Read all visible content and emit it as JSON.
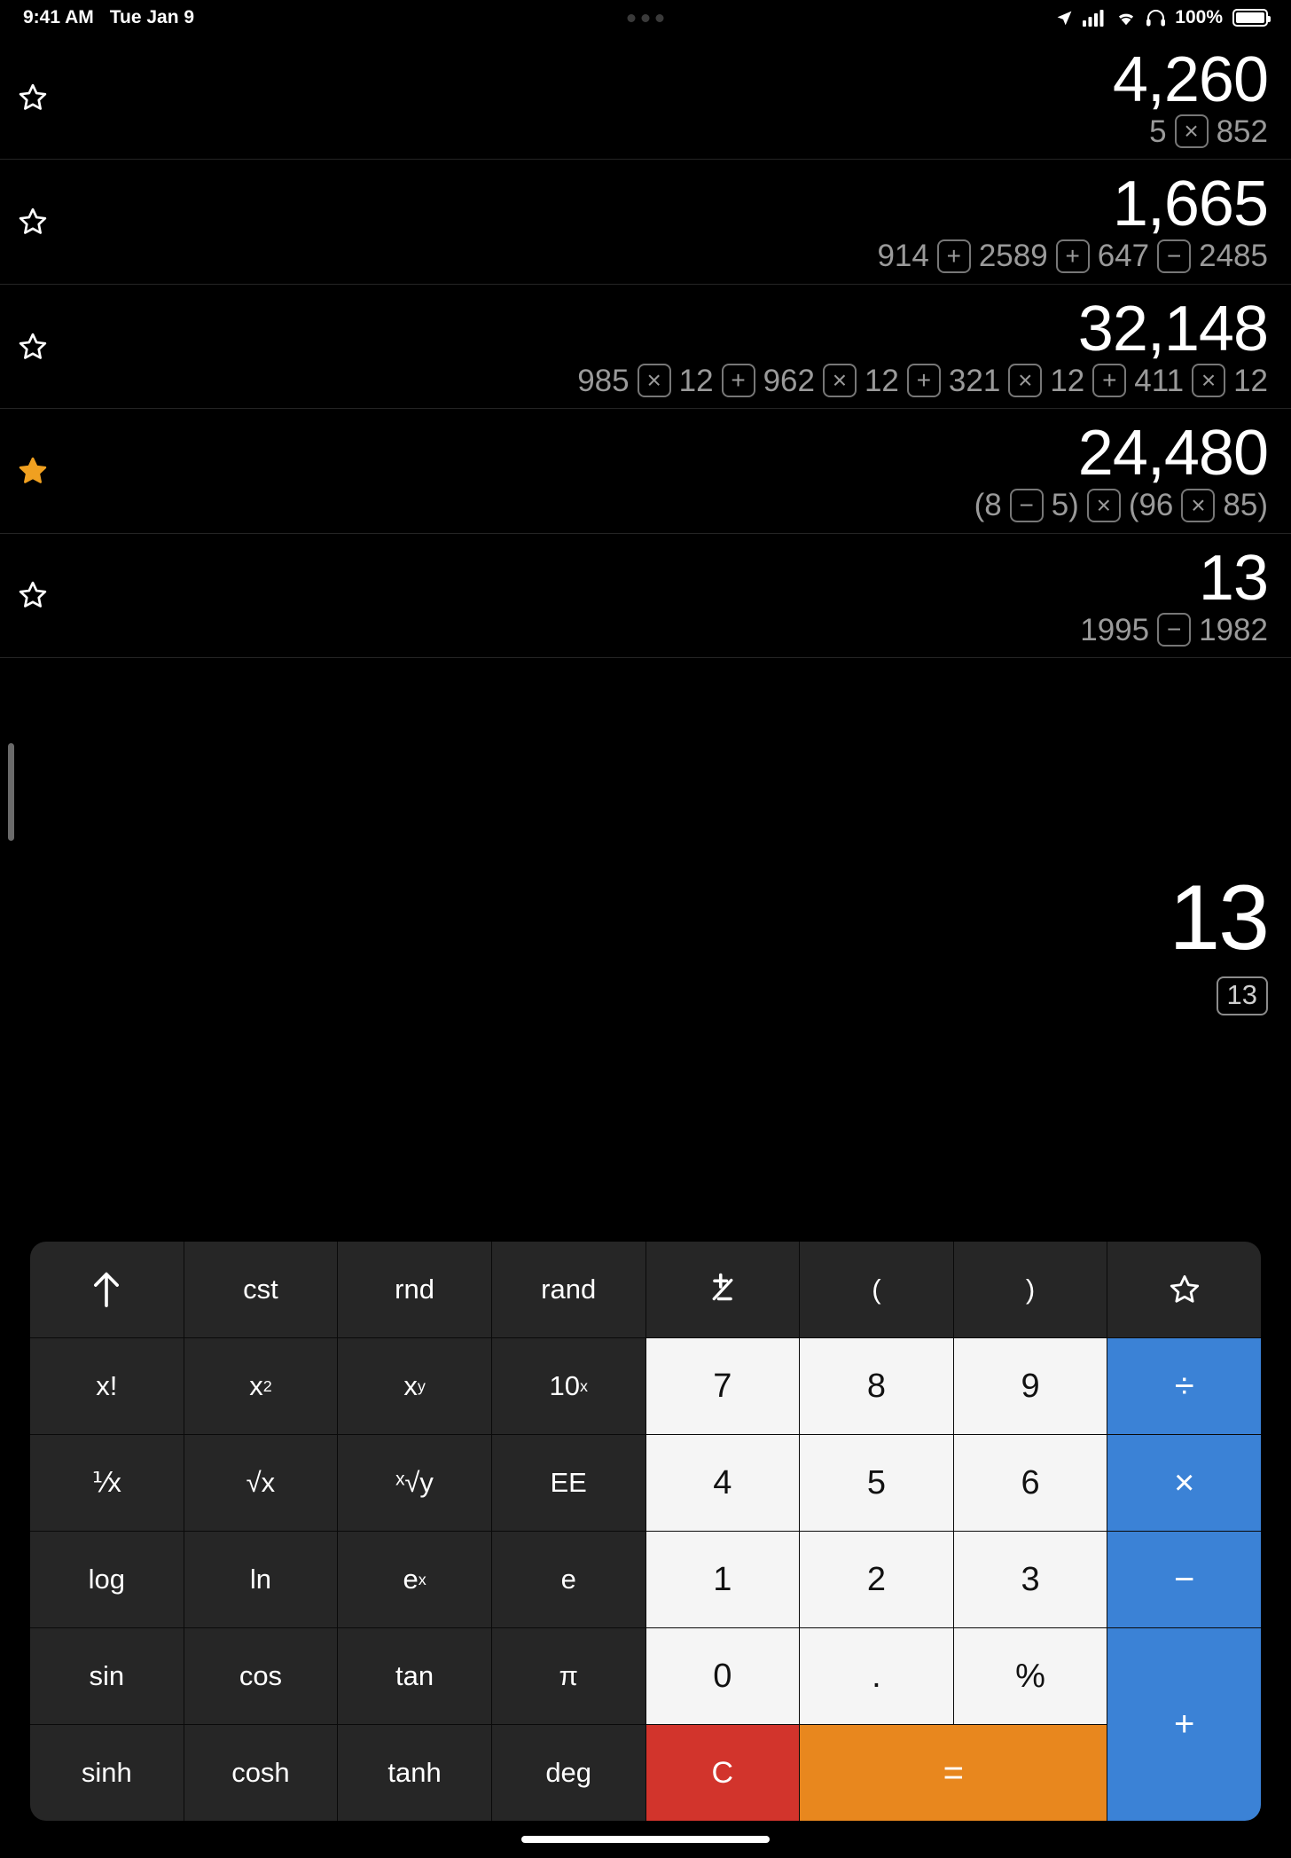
{
  "status_bar": {
    "time": "9:41 AM",
    "date": "Tue Jan 9",
    "battery_percent": "100%",
    "icons": [
      "location-arrow-icon",
      "cellular-signal-icon",
      "wifi-icon",
      "headphones-icon",
      "battery-icon"
    ]
  },
  "history": [
    {
      "starred": false,
      "result": "4,260",
      "tokens": [
        {
          "type": "num",
          "text": "5"
        },
        {
          "type": "op",
          "text": "×"
        },
        {
          "type": "num",
          "text": "852"
        }
      ]
    },
    {
      "starred": false,
      "result": "1,665",
      "tokens": [
        {
          "type": "num",
          "text": "914"
        },
        {
          "type": "op",
          "text": "+"
        },
        {
          "type": "num",
          "text": "2589"
        },
        {
          "type": "op",
          "text": "+"
        },
        {
          "type": "num",
          "text": "647"
        },
        {
          "type": "op",
          "text": "−"
        },
        {
          "type": "num",
          "text": "2485"
        }
      ]
    },
    {
      "starred": false,
      "result": "32,148",
      "tokens": [
        {
          "type": "num",
          "text": "985"
        },
        {
          "type": "op",
          "text": "×"
        },
        {
          "type": "num",
          "text": "12"
        },
        {
          "type": "op",
          "text": "+"
        },
        {
          "type": "num",
          "text": "962"
        },
        {
          "type": "op",
          "text": "×"
        },
        {
          "type": "num",
          "text": "12"
        },
        {
          "type": "op",
          "text": "+"
        },
        {
          "type": "num",
          "text": "321"
        },
        {
          "type": "op",
          "text": "×"
        },
        {
          "type": "num",
          "text": "12"
        },
        {
          "type": "op",
          "text": "+"
        },
        {
          "type": "num",
          "text": "411"
        },
        {
          "type": "op",
          "text": "×"
        },
        {
          "type": "num",
          "text": "12"
        }
      ]
    },
    {
      "starred": true,
      "result": "24,480",
      "tokens": [
        {
          "type": "num",
          "text": "(8"
        },
        {
          "type": "op",
          "text": "−"
        },
        {
          "type": "num",
          "text": "5)"
        },
        {
          "type": "op",
          "text": "×"
        },
        {
          "type": "num",
          "text": "(96"
        },
        {
          "type": "op",
          "text": "×"
        },
        {
          "type": "num",
          "text": "85)"
        }
      ]
    },
    {
      "starred": false,
      "result": "13",
      "tokens": [
        {
          "type": "num",
          "text": "1995"
        },
        {
          "type": "op",
          "text": "−"
        },
        {
          "type": "num",
          "text": "1982"
        }
      ]
    }
  ],
  "current": {
    "result": "13",
    "expression_chip": "13"
  },
  "keypad": {
    "rows": [
      [
        {
          "label": "↑",
          "kind": "fn",
          "name": "key-up-arrow",
          "icon": "arrow-up-icon"
        },
        {
          "label": "cst",
          "kind": "fn",
          "name": "key-cst"
        },
        {
          "label": "rnd",
          "kind": "fn",
          "name": "key-rnd"
        },
        {
          "label": "rand",
          "kind": "fn",
          "name": "key-rand"
        },
        {
          "label": "±",
          "kind": "fn",
          "name": "key-plus-minus",
          "icon": "plus-minus-icon"
        },
        {
          "label": "(",
          "kind": "fn",
          "name": "key-open-paren"
        },
        {
          "label": ")",
          "kind": "fn",
          "name": "key-close-paren"
        },
        {
          "label": "☆",
          "kind": "fn",
          "name": "key-favorite",
          "icon": "star-outline-icon"
        }
      ],
      [
        {
          "label": "x!",
          "kind": "fn",
          "name": "key-factorial"
        },
        {
          "label": "x2",
          "kind": "fn",
          "name": "key-x-squared",
          "base": "x",
          "sup": "2"
        },
        {
          "label": "xy",
          "kind": "fn",
          "name": "key-x-power-y",
          "base": "x",
          "sup": "y"
        },
        {
          "label": "10x",
          "kind": "fn",
          "name": "key-ten-power-x",
          "base": "10",
          "sup": "x"
        },
        {
          "label": "7",
          "kind": "num",
          "name": "key-7"
        },
        {
          "label": "8",
          "kind": "num",
          "name": "key-8"
        },
        {
          "label": "9",
          "kind": "num",
          "name": "key-9"
        },
        {
          "label": "÷",
          "kind": "op",
          "name": "key-divide"
        }
      ],
      [
        {
          "label": "⅟x",
          "kind": "fn",
          "name": "key-reciprocal"
        },
        {
          "label": "√x",
          "kind": "fn",
          "name": "key-square-root"
        },
        {
          "label": "ˣ√y",
          "kind": "fn",
          "name": "key-nth-root"
        },
        {
          "label": "EE",
          "kind": "fn",
          "name": "key-ee"
        },
        {
          "label": "4",
          "kind": "num",
          "name": "key-4"
        },
        {
          "label": "5",
          "kind": "num",
          "name": "key-5"
        },
        {
          "label": "6",
          "kind": "num",
          "name": "key-6"
        },
        {
          "label": "×",
          "kind": "op",
          "name": "key-multiply"
        }
      ],
      [
        {
          "label": "log",
          "kind": "fn",
          "name": "key-log"
        },
        {
          "label": "ln",
          "kind": "fn",
          "name": "key-ln"
        },
        {
          "label": "ex",
          "kind": "fn",
          "name": "key-e-power-x",
          "base": "e",
          "sup": "x"
        },
        {
          "label": "e",
          "kind": "fn",
          "name": "key-e"
        },
        {
          "label": "1",
          "kind": "num",
          "name": "key-1"
        },
        {
          "label": "2",
          "kind": "num",
          "name": "key-2"
        },
        {
          "label": "3",
          "kind": "num",
          "name": "key-3"
        },
        {
          "label": "−",
          "kind": "op",
          "name": "key-subtract"
        }
      ],
      [
        {
          "label": "sin",
          "kind": "fn",
          "name": "key-sin"
        },
        {
          "label": "cos",
          "kind": "fn",
          "name": "key-cos"
        },
        {
          "label": "tan",
          "kind": "fn",
          "name": "key-tan"
        },
        {
          "label": "π",
          "kind": "fn",
          "name": "key-pi"
        },
        {
          "label": "0",
          "kind": "num",
          "name": "key-0"
        },
        {
          "label": ".",
          "kind": "num",
          "name": "key-decimal"
        },
        {
          "label": "%",
          "kind": "num",
          "name": "key-percent"
        },
        {
          "label": "+",
          "kind": "op",
          "name": "key-add",
          "tall": true
        }
      ],
      [
        {
          "label": "sinh",
          "kind": "fn",
          "name": "key-sinh"
        },
        {
          "label": "cosh",
          "kind": "fn",
          "name": "key-cosh"
        },
        {
          "label": "tanh",
          "kind": "fn",
          "name": "key-tanh"
        },
        {
          "label": "deg",
          "kind": "fn",
          "name": "key-deg"
        },
        {
          "label": "C",
          "kind": "clear",
          "name": "key-clear"
        },
        {
          "label": "=",
          "kind": "eq",
          "name": "key-equals",
          "wide": true
        }
      ]
    ]
  },
  "colors": {
    "accent_blue": "#3b82d6",
    "equals_orange": "#e8871e",
    "clear_red": "#d2342c",
    "star_gold": "#f0a020",
    "key_dark": "#262626",
    "key_light": "#f5f5f5"
  }
}
